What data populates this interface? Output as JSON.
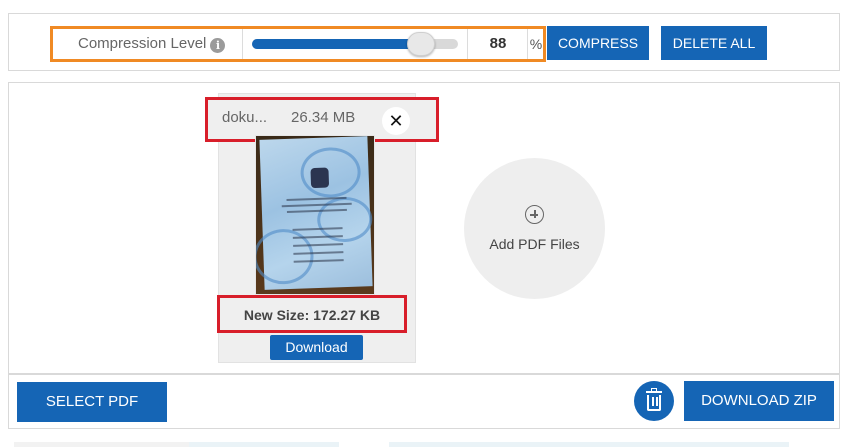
{
  "toolbar": {
    "compression_label": "Compression Level",
    "info_glyph": "i",
    "level_value": "88",
    "level_unit": "%",
    "slider_fraction": 0.82,
    "compress_label": "COMPRESS",
    "delete_all_label": "DELETE ALL"
  },
  "file_card": {
    "file_name": "doku...",
    "original_size": "26.34 MB",
    "close_glyph": "✕",
    "new_size": "New Size: 172.27 KB",
    "download_label": "Download"
  },
  "add_files": {
    "label": "Add PDF Files"
  },
  "bottom": {
    "select_pdf_label": "SELECT PDF",
    "download_zip_label": "DOWNLOAD ZIP"
  },
  "colors": {
    "accent_blue": "#1565b5",
    "highlight_orange": "#f08a24",
    "highlight_red": "#d81e2a"
  },
  "icons": [
    "info-icon",
    "close-icon",
    "plus-circle-icon",
    "trash-icon",
    "document-thumbnail"
  ]
}
